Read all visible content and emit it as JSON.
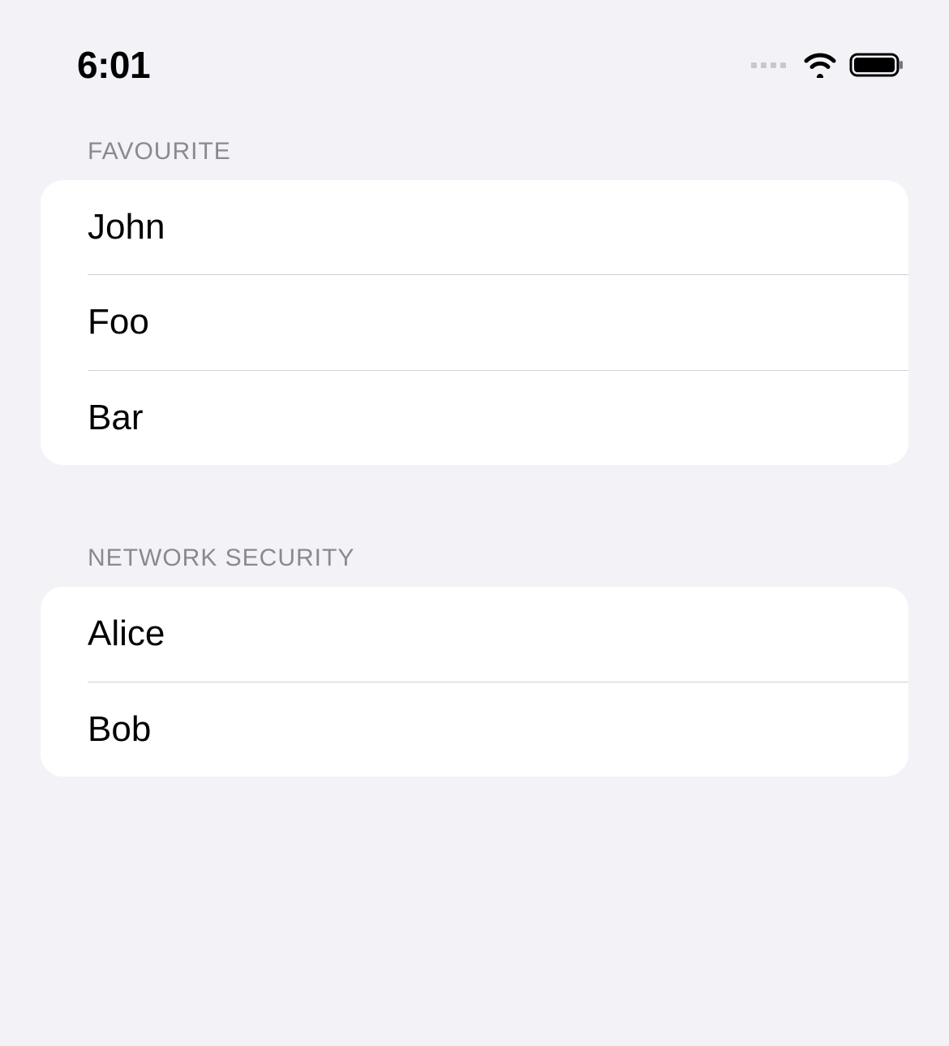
{
  "status_bar": {
    "time": "6:01"
  },
  "sections": [
    {
      "header": "FAVOURITE",
      "items": [
        "John",
        "Foo",
        "Bar"
      ]
    },
    {
      "header": "NETWORK SECURITY",
      "items": [
        "Alice",
        "Bob"
      ]
    }
  ]
}
